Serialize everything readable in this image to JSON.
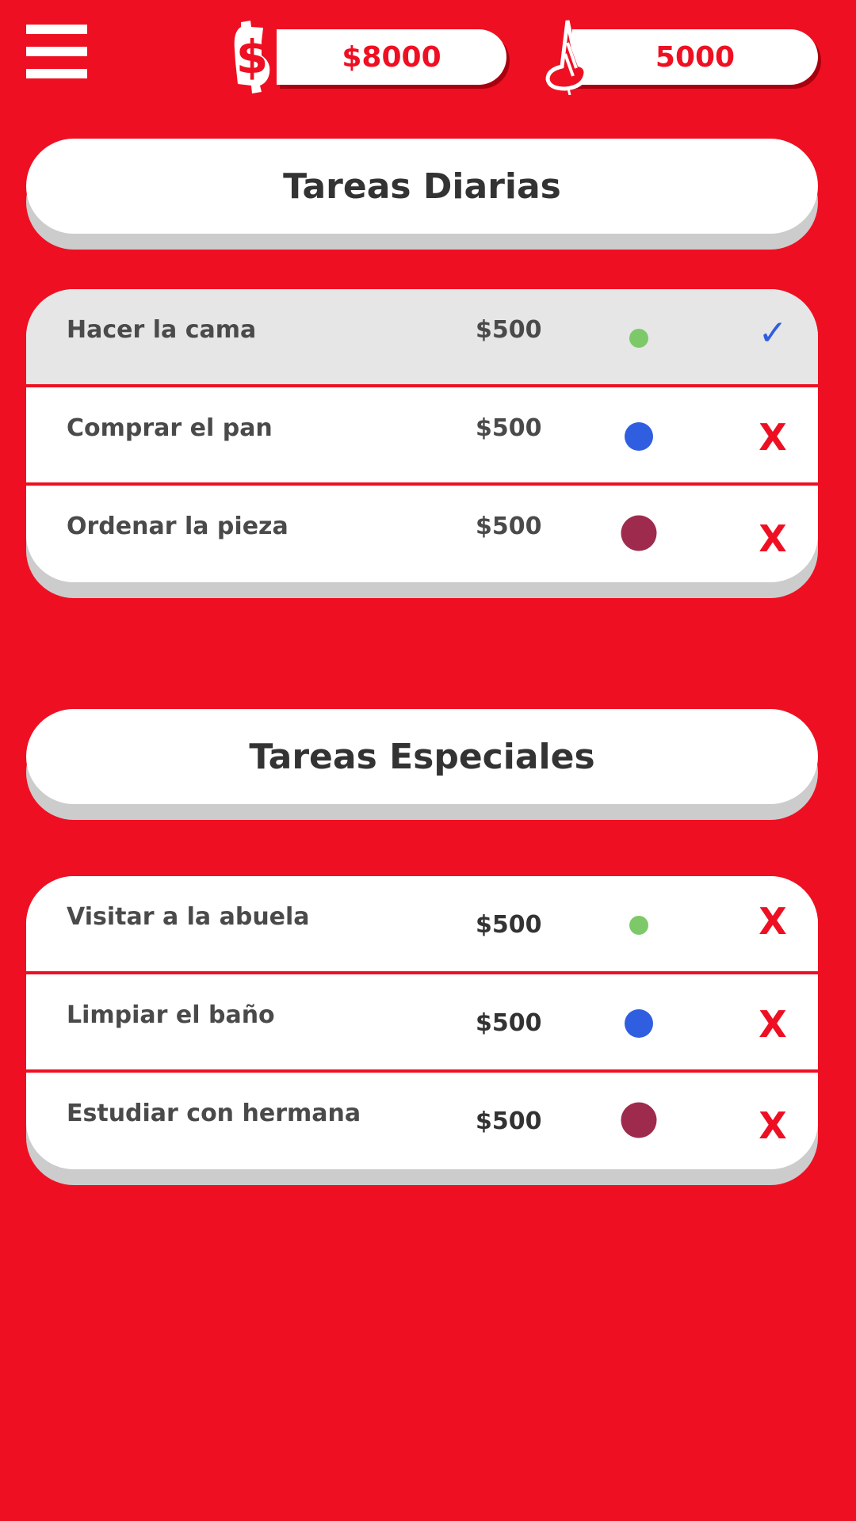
{
  "header": {
    "menu_icon": "hamburger-menu-icon",
    "money": {
      "icon": "dollar-icon",
      "value": "$8000"
    },
    "points": {
      "icon": "flame-icon",
      "value": "5000"
    }
  },
  "colors": {
    "background": "#ee1022",
    "green": "#7dc96a",
    "blue": "#2f5fe0",
    "purple": "#9e2b4d",
    "done_row": "#e6e6e6"
  },
  "daily": {
    "title": "Tareas Diarias",
    "tasks": [
      {
        "name": "Hacer la cama",
        "price": "$500",
        "difficulty": "small-green",
        "status": "✓",
        "done": true
      },
      {
        "name": "Comprar el pan",
        "price": "$500",
        "difficulty": "medium-blue",
        "status": "X",
        "done": false
      },
      {
        "name": "Ordenar la pieza",
        "price": "$500",
        "difficulty": "large-purple",
        "status": "X",
        "done": false
      }
    ]
  },
  "special": {
    "title": "Tareas Especiales",
    "tasks": [
      {
        "name": "Visitar a la abuela",
        "price": "$500",
        "difficulty": "small-green",
        "status": "X",
        "done": false
      },
      {
        "name": "Limpiar el baño",
        "price": "$500",
        "difficulty": "medium-blue",
        "status": "X",
        "done": false
      },
      {
        "name": "Estudiar con hermana",
        "price": "$500",
        "difficulty": "large-purple",
        "status": "X",
        "done": false
      }
    ]
  }
}
